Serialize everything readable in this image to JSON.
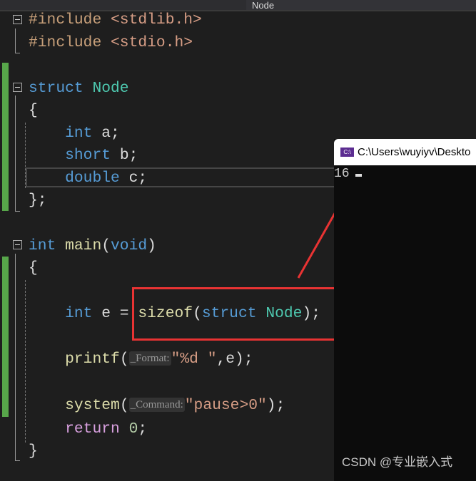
{
  "tab": {
    "label": "Node"
  },
  "code": {
    "l1": {
      "pp": "#include",
      "hdr": "<stdlib.h>"
    },
    "l2": {
      "pp": "#include",
      "hdr": "<stdio.h>"
    },
    "l3": {
      "kw": "struct",
      "ty": "Node"
    },
    "l4": "{",
    "l5": {
      "kw": "int",
      "rest": "a;"
    },
    "l6": {
      "kw": "short",
      "rest": "b;"
    },
    "l7": {
      "kw": "double",
      "rest": "c;"
    },
    "l8": "};",
    "l9": {
      "kw": "int",
      "fn": "main",
      "p1": "(",
      "arg": "void",
      "p2": ")"
    },
    "l10": "{",
    "l11": {
      "kw": "int",
      "var": "e =",
      "fn": "sizeof",
      "p1": "(",
      "kw2": "struct",
      "ty": "Node",
      "p2": ");"
    },
    "l12": {
      "fn": "printf",
      "p1": "(",
      "hint": "_Format:",
      "str": "\"%d \"",
      "rest": ",e);"
    },
    "l13": {
      "fn": "system",
      "p1": "(",
      "hint": "_Command:",
      "str": "\"pause>0\"",
      "rest": ");"
    },
    "l14": {
      "kw": "return",
      "num": "0",
      "rest": ";"
    },
    "l15": "}"
  },
  "console": {
    "title": "C:\\Users\\wuyiyv\\Deskto",
    "icon": "console-icon",
    "output": "16"
  },
  "watermark": "CSDN @专业嵌入式",
  "colors": {
    "annotation": "#e83333",
    "console_bg": "#0c0c0c",
    "editor_bg": "#1e1e1e"
  }
}
